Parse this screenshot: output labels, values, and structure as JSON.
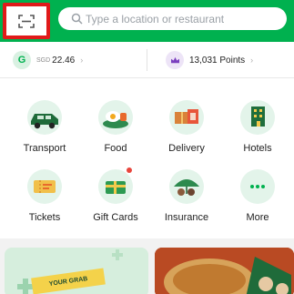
{
  "header": {
    "scan_icon": "qr-scan-icon",
    "search_icon": "search-icon",
    "search_placeholder": "Type a location or restaurant",
    "highlight_color": "#e01a1a",
    "brand_color": "#00b14f"
  },
  "wallet": {
    "badge": "G",
    "currency": "SGD",
    "amount": "22.46",
    "chevron": "›"
  },
  "rewards": {
    "icon": "crown-icon",
    "points": "13,031 Points",
    "chevron": "›"
  },
  "services": [
    {
      "label": "Transport",
      "icon": "car-icon"
    },
    {
      "label": "Food",
      "icon": "food-icon"
    },
    {
      "label": "Delivery",
      "icon": "delivery-icon"
    },
    {
      "label": "Hotels",
      "icon": "hotel-icon"
    },
    {
      "label": "Tickets",
      "icon": "ticket-icon"
    },
    {
      "label": "Gift Cards",
      "icon": "gift-card-icon",
      "badge": "new-dot"
    },
    {
      "label": "Insurance",
      "icon": "umbrella-icon"
    },
    {
      "label": "More",
      "icon": "more-icon"
    }
  ],
  "promo": {
    "left_text": "YOUR GRAB"
  }
}
